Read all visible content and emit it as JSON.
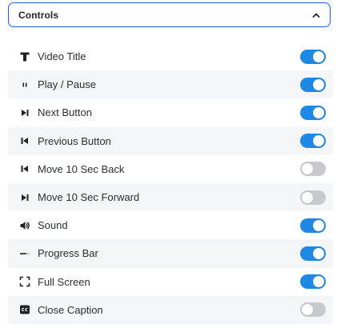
{
  "panel": {
    "title": "Controls",
    "expanded": true,
    "toggle_on_color": "#1e88e5",
    "toggle_off_color": "#c7c9cc",
    "accent_border": "#1e5fd8"
  },
  "controls": [
    {
      "label": "Video Title",
      "icon": "text-icon",
      "enabled": true
    },
    {
      "label": "Play / Pause",
      "icon": "pause-icon",
      "enabled": true
    },
    {
      "label": "Next Button",
      "icon": "skip-next-icon",
      "enabled": true
    },
    {
      "label": "Previous Button",
      "icon": "skip-previous-icon",
      "enabled": true
    },
    {
      "label": "Move 10 Sec Back",
      "icon": "skip-previous-icon",
      "enabled": false
    },
    {
      "label": "Move 10 Sec Forward",
      "icon": "skip-next-icon",
      "enabled": false
    },
    {
      "label": "Sound",
      "icon": "volume-icon",
      "enabled": true
    },
    {
      "label": "Progress Bar",
      "icon": "progress-bar-icon",
      "enabled": true
    },
    {
      "label": "Full Screen",
      "icon": "fullscreen-icon",
      "enabled": true
    },
    {
      "label": "Close Caption",
      "icon": "closed-caption-icon",
      "enabled": false
    }
  ]
}
